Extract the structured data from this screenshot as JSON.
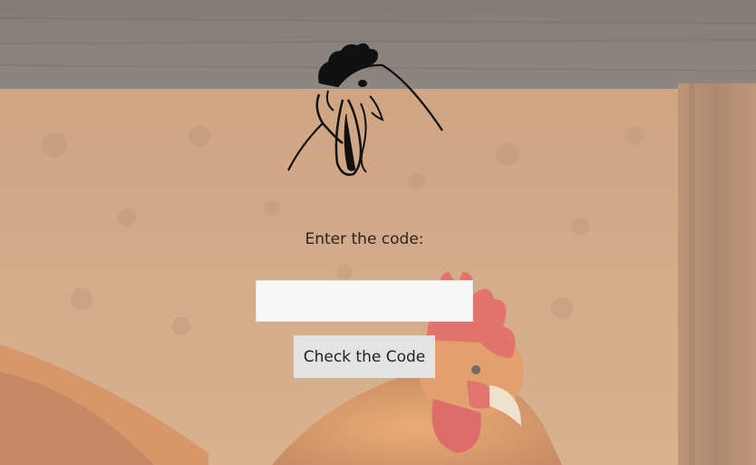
{
  "form": {
    "prompt": "Enter the code:",
    "code_value": "",
    "code_placeholder": "",
    "submit_label": "Check the Code"
  },
  "logo": {
    "icon": "rooster-head-logo-icon"
  },
  "background": {
    "icon": "hen-in-wooden-coop-image"
  }
}
